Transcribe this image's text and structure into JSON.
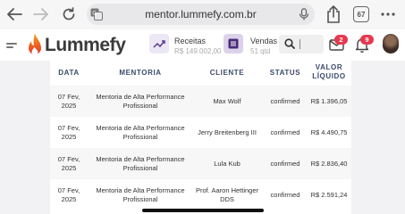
{
  "browser": {
    "url": "mentor.lummefy.com.br",
    "tab_count": "67",
    "icons": [
      "back-arrow-icon",
      "forward-arrow-icon",
      "reload-icon",
      "translate-icon",
      "microphone-icon",
      "share-icon",
      "tabs-icon",
      "more-dots-icon"
    ]
  },
  "header": {
    "logo_text": "Lummefy",
    "receitas": {
      "label": "Receitas",
      "value": "R$ 149.002,00"
    },
    "vendas": {
      "label": "Vendas",
      "value": "51 qtd"
    },
    "messages_badge": "2",
    "notifications_badge": "9"
  },
  "table": {
    "columns": [
      "DATA",
      "MENTORIA",
      "CLIENTE",
      "STATUS",
      "VALOR LÍQUIDO"
    ],
    "rows": [
      {
        "date": "07 Fev, 2025",
        "mentoria": "Mentoria de Alta Performance Profissional",
        "cliente": "Max Wolf",
        "status": "confirmed",
        "valor": "R$ 1.396,05"
      },
      {
        "date": "07 Fev, 2025",
        "mentoria": "Mentoria de Alta Performance Profissional",
        "cliente": "Jerry Breitenberg III",
        "status": "confirmed",
        "valor": "R$ 4.490,75"
      },
      {
        "date": "07 Fev, 2025",
        "mentoria": "Mentoria de Alta Performance Profissional",
        "cliente": "Lula Kub",
        "status": "confirmed",
        "valor": "R$ 2.836,40"
      },
      {
        "date": "07 Fev, 2025",
        "mentoria": "Mentoria de Alta Performance Profissional",
        "cliente": "Prof. Aaron Hettinger DDS",
        "status": "confirmed",
        "valor": "R$ 2.591,24"
      }
    ]
  },
  "colors": {
    "accent": "#6a4a9a",
    "badge": "#e63950",
    "header_text": "#3b4a6b"
  }
}
